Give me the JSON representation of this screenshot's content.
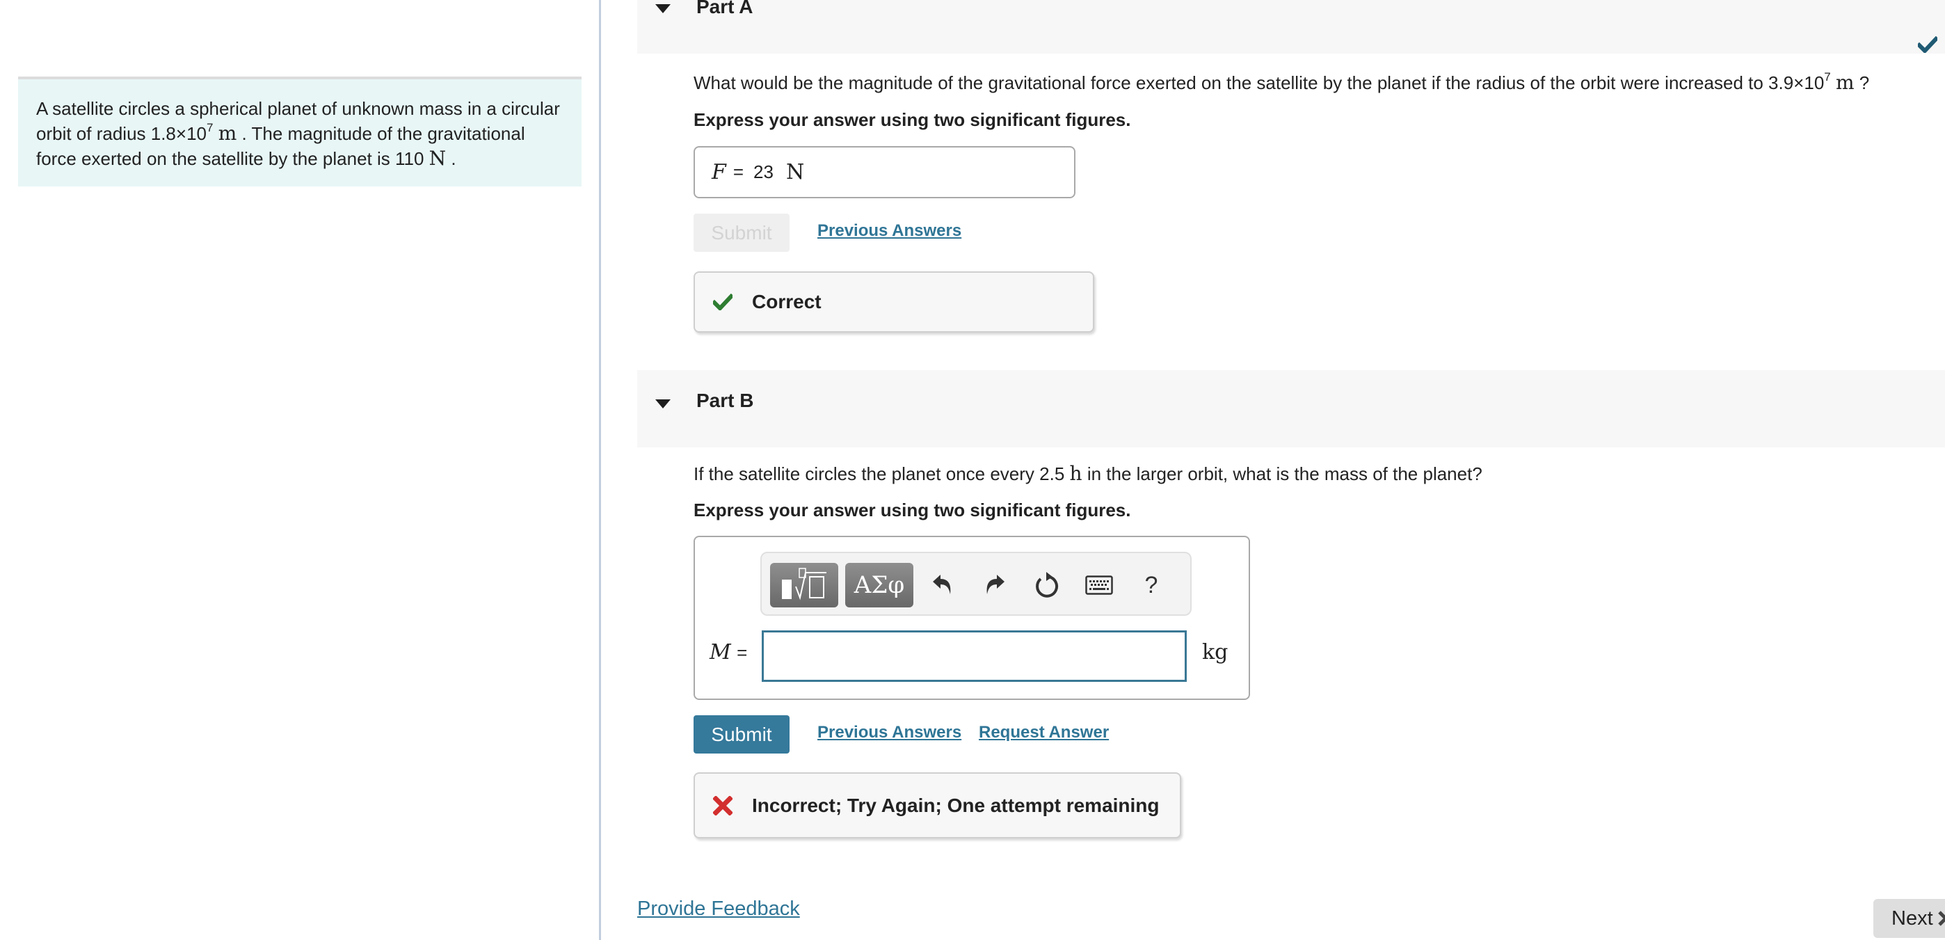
{
  "intro": {
    "text_1": "A satellite circles a spherical planet of unknown mass in a circular orbit of radius 1.8×10",
    "exp_1": "7",
    "unit_1": "m",
    "text_2": ". The magnitude of the gravitational force exerted on the satellite by the planet is 110",
    "unit_2": "N",
    "text_3": "."
  },
  "part_a": {
    "title": "Part A",
    "status": "correct",
    "question_1": "What would be the magnitude of the gravitational force exerted on the satellite by the planet if the radius of the orbit were increased to 3.9×10",
    "question_exp": "7",
    "question_unit": "m",
    "question_end": "?",
    "instruction": "Express your answer using two significant figures.",
    "answer": {
      "variable": "F",
      "equals": "=",
      "value": "23",
      "unit": "N"
    },
    "submit_label": "Submit",
    "previous_answers_label": "Previous Answers",
    "feedback": "Correct"
  },
  "part_b": {
    "title": "Part B",
    "question_1": "If the satellite circles the planet once every 2.5",
    "question_unit": "h",
    "question_2": "in the larger orbit, what is the mass of the planet?",
    "instruction": "Express your answer using two significant figures.",
    "toolbar": {
      "templates_label": "■√□",
      "symbols_label": "ΑΣφ",
      "undo": "undo-icon",
      "redo": "redo-icon",
      "reset": "reset-icon",
      "keyboard": "keyboard-icon",
      "help_label": "?"
    },
    "answer": {
      "variable": "M",
      "equals": "=",
      "value": "",
      "unit": "kg"
    },
    "submit_label": "Submit",
    "previous_answers_label": "Previous Answers",
    "request_answer_label": "Request Answer",
    "feedback": "Incorrect; Try Again; One attempt remaining"
  },
  "footer": {
    "provide_feedback_label": "Provide Feedback",
    "next_label": "Next"
  },
  "colors": {
    "accent": "#35799b",
    "link": "#2f7596",
    "correct_green": "#2e7d32",
    "incorrect_red": "#d32f2f",
    "check_dark": "#1f5a73",
    "intro_bg": "#e8f6f6"
  }
}
